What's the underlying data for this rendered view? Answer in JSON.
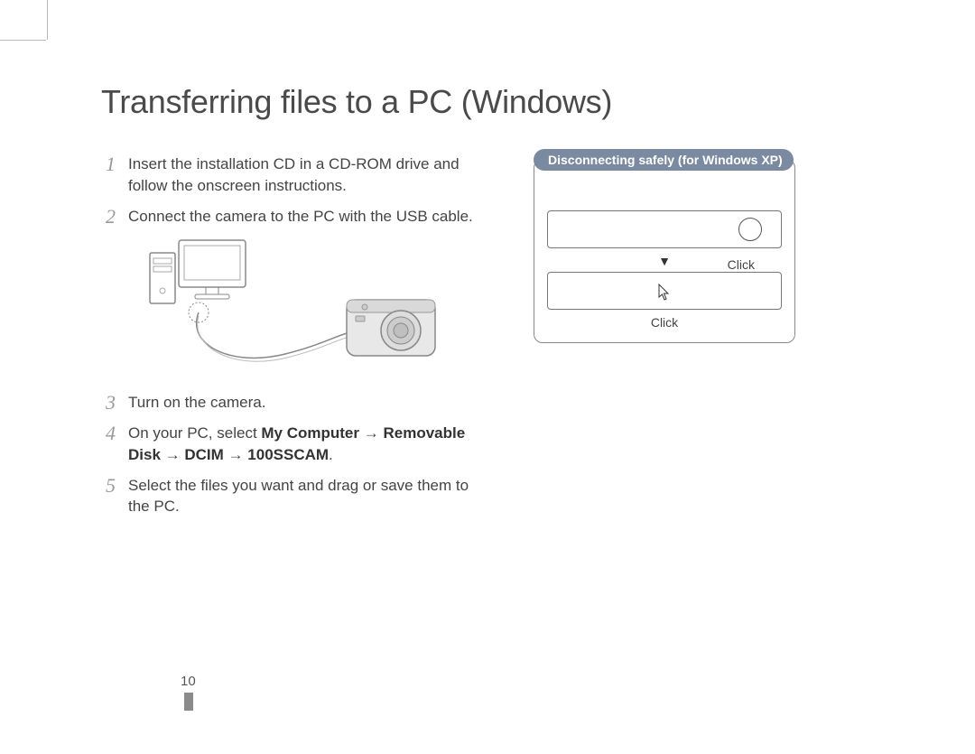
{
  "title": "Transferring files to a PC (Windows)",
  "steps": [
    {
      "num": "1",
      "text_a": "Insert the installation CD in a CD-ROM drive and follow the onscreen instructions."
    },
    {
      "num": "2",
      "text_a": "Connect the camera to the PC with the USB cable."
    },
    {
      "num": "3",
      "text_a": "Turn on the camera."
    },
    {
      "num": "4",
      "text_a": "On your PC, select ",
      "bold1": "My Computer",
      "arrow": " → ",
      "bold2": "Removable Disk",
      "bold3": "DCIM",
      "bold4": "100SSCAM",
      "period": "."
    },
    {
      "num": "5",
      "text_a": "Select the files you want and drag or save them to the PC."
    }
  ],
  "sidebox": {
    "tab": "Disconnecting safely (for Windows XP)",
    "click1": "Click",
    "down": "▼",
    "click2": "Click"
  },
  "page_number": "10"
}
